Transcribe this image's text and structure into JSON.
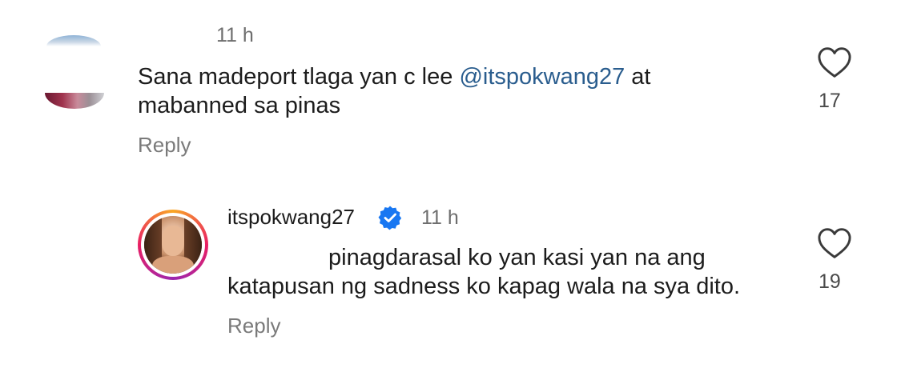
{
  "comment": {
    "time": "11 h",
    "text_before": "Sana madeport tlaga yan c lee ",
    "mention": "@itspokwang27",
    "text_after": "  at mabanned sa pinas",
    "reply_label": "Reply",
    "like_count": "17"
  },
  "reply": {
    "username": "itspokwang27",
    "time": "11 h",
    "text_line1": "pinagdarasal ko yan kasi yan na ang",
    "text_line2": "katapusan ng sadness ko kapag wala na sya dito.",
    "reply_label": "Reply",
    "like_count": "19"
  },
  "colors": {
    "mention": "#2a5d8e",
    "verified": "#1877f2",
    "muted": "#7a7a7a"
  },
  "icons": {
    "like": "heart-icon",
    "verified": "verified-badge-icon"
  }
}
